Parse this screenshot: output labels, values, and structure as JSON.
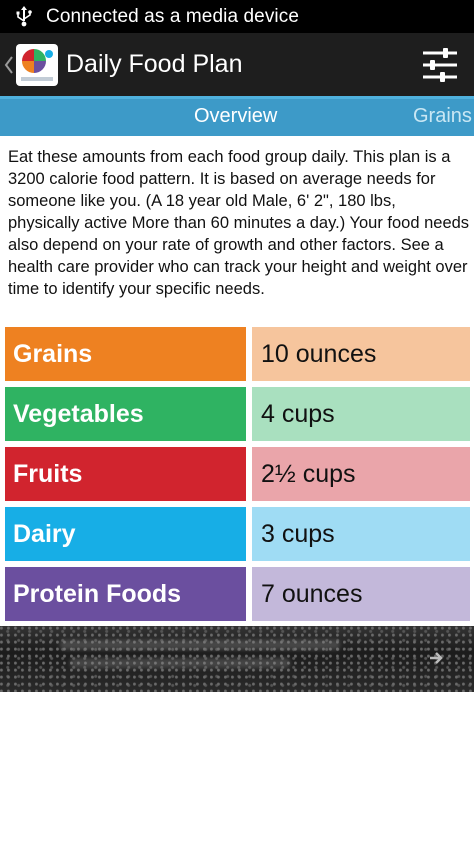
{
  "status_bar": {
    "text": "Connected as a media device"
  },
  "action_bar": {
    "title": "Daily Food Plan"
  },
  "tabs": [
    {
      "label": "Overview"
    },
    {
      "label": "Grains"
    }
  ],
  "intro": "Eat these amounts from each food group daily. This plan is a 3200 calorie food pattern. It is based on average needs for someone like you. (A 18 year old Male, 6' 2\", 180 lbs, physically active More than 60 minutes a day.) Your food needs also depend on your rate of growth and other factors. See a health care provider who can track your height and weight over time to identify your specific needs.",
  "food_groups": [
    {
      "name": "Grains",
      "amount": "10 ounces",
      "color": "#ee8121",
      "light_color": "#f6c59d"
    },
    {
      "name": "Vegetables",
      "amount": "4 cups",
      "color": "#2fb362",
      "light_color": "#a9e0bf"
    },
    {
      "name": "Fruits",
      "amount": "2½ cups",
      "color": "#d1242e",
      "light_color": "#eaa5aa"
    },
    {
      "name": "Dairy",
      "amount": "3 cups",
      "color": "#17aee6",
      "light_color": "#9fdcf4"
    },
    {
      "name": "Protein Foods",
      "amount": "7 ounces",
      "color": "#6b4f9f",
      "light_color": "#c3b8da"
    }
  ],
  "icons": {
    "usb": "usb-icon",
    "back": "chevron-left-icon",
    "logo": "myplate-logo",
    "settings": "sliders-icon"
  }
}
